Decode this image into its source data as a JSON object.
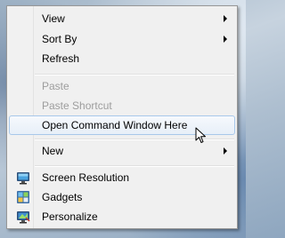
{
  "menu": {
    "view": "View",
    "sort_by": "Sort By",
    "refresh": "Refresh",
    "paste": "Paste",
    "paste_shortcut": "Paste Shortcut",
    "open_command_window": "Open Command Window Here",
    "new": "New",
    "screen_resolution": "Screen Resolution",
    "gadgets": "Gadgets",
    "personalize": "Personalize"
  },
  "icons": {
    "screen_resolution": "monitor-icon",
    "gadgets": "gadgets-icon",
    "personalize": "personalize-icon"
  },
  "colors": {
    "menu_background": "#f0f0f0",
    "highlight_border": "#a8c8ea",
    "disabled_text": "#9d9d9d"
  }
}
